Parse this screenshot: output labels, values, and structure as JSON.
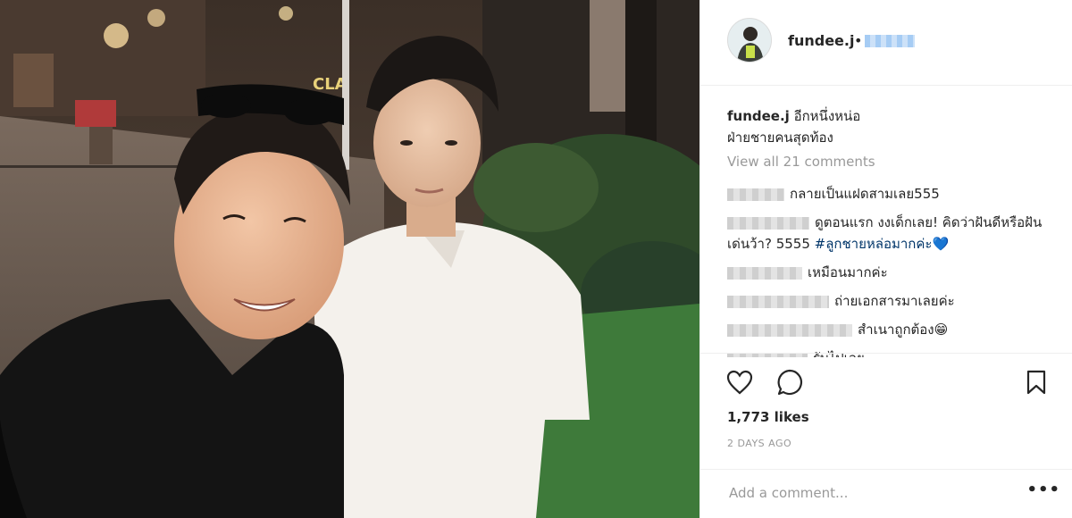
{
  "post": {
    "username": "fundee.j",
    "separator": "•",
    "caption_line1": "อีกหนึ่งหน่อ",
    "caption_line2": "ฝ่ายชายคนสุดท้อง",
    "view_all": "View all 21 comments",
    "comments": [
      {
        "text": "กลายเป็นแฝดสามเลย555"
      },
      {
        "text": "ดูตอนแรก งงเด็กเลย! คิดว่าฝันดีหรือฝันเด่นว้า? 5555",
        "tag": "#ลูกชายหล่อมากค่ะ",
        "emoji": "💙"
      },
      {
        "text": "เหมือนมากค่ะ"
      },
      {
        "text": "ถ่ายเอกสารมาเลยค่ะ"
      },
      {
        "text": "สำเนาถูกต้อง😁"
      },
      {
        "text": "รับไปเลย"
      }
    ],
    "likes": "1,773 likes",
    "time_ago": "2 DAYS AGO",
    "add_comment_placeholder": "Add a comment...",
    "more_label": "•••"
  },
  "photo": {
    "sign_text": "CLA"
  },
  "icons": {
    "like": "heart-icon",
    "comment": "speech-bubble-icon",
    "save": "bookmark-icon",
    "more": "ellipsis-icon"
  },
  "colors": {
    "hashtag": "#003569",
    "muted": "#999999",
    "border": "#efefef"
  }
}
